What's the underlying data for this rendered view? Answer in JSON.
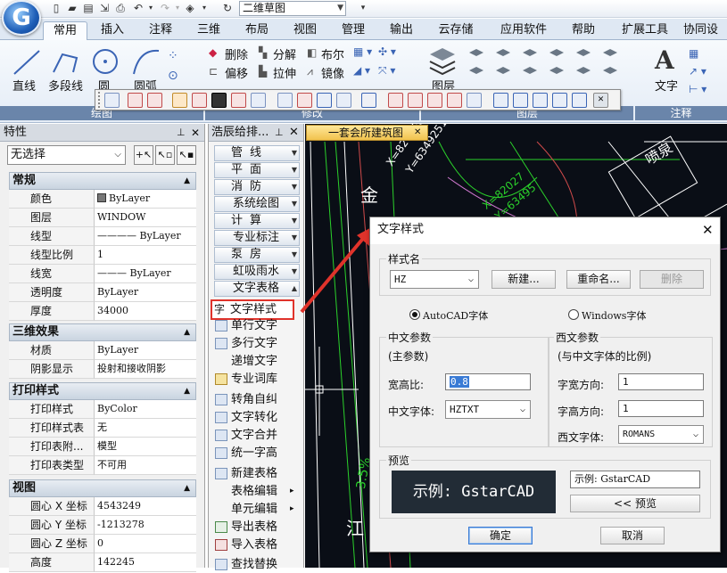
{
  "app": {
    "logo": "G",
    "view_selector": "二维草图"
  },
  "ribbon": {
    "tabs": [
      "常用",
      "插入",
      "注释",
      "三维",
      "布局",
      "视图",
      "管理",
      "输出",
      "云存储",
      "应用软件",
      "帮助",
      "扩展工具",
      "协同设"
    ],
    "active_tab": "常用",
    "draw_tools": [
      "直线",
      "多段线",
      "圆",
      "圆弧"
    ],
    "modify_tools": [
      "删除",
      "分解",
      "布尔",
      "偏移",
      "拉伸",
      "镜像"
    ],
    "big_tools": [
      "图层",
      "文字"
    ],
    "group_labels": [
      "绘图",
      "修改",
      "图层",
      "注释"
    ]
  },
  "properties": {
    "title": "特性",
    "selection": "无选择",
    "sections": [
      {
        "name": "常规",
        "rows": [
          [
            "颜色",
            "ByLayer"
          ],
          [
            "图层",
            "WINDOW"
          ],
          [
            "线型",
            "———— ByLayer"
          ],
          [
            "线型比例",
            "1"
          ],
          [
            "线宽",
            "——— ByLayer"
          ],
          [
            "透明度",
            "ByLayer"
          ],
          [
            "厚度",
            "34000"
          ]
        ]
      },
      {
        "name": "三维效果",
        "rows": [
          [
            "材质",
            "ByLayer"
          ],
          [
            "阴影显示",
            "投射和接收阴影"
          ]
        ]
      },
      {
        "name": "打印样式",
        "rows": [
          [
            "打印样式",
            "ByColor"
          ],
          [
            "打印样式表",
            "无"
          ],
          [
            "打印表附...",
            "模型"
          ],
          [
            "打印表类型",
            "不可用"
          ]
        ]
      },
      {
        "name": "视图",
        "rows": [
          [
            "圆心 X 坐标",
            "4543249"
          ],
          [
            "圆心 Y 坐标",
            "-1213278"
          ],
          [
            "圆心 Z 坐标",
            "0"
          ],
          [
            "高度",
            "142245"
          ]
        ]
      }
    ]
  },
  "palette": {
    "title": "浩辰给排...",
    "categories": [
      "管线",
      "平面",
      "消防",
      "系统绘图",
      "计算",
      "专业标注",
      "泵房",
      "虹吸雨水",
      "文字表格"
    ],
    "items": [
      "文字样式",
      "单行文字",
      "多行文字",
      "递增文字",
      "专业词库",
      "转角自纠",
      "文字转化",
      "文字合并",
      "统一字高",
      "新建表格",
      "表格编辑",
      "单元编辑",
      "导出表格",
      "导入表格",
      "查找替换"
    ]
  },
  "drawing": {
    "tab": "一套会所建筑图",
    "labels": [
      "金",
      "江",
      "喷泉",
      "X=8202583",
      "Y=6349251",
      "X=82027",
      "Y=63495",
      "3.5%"
    ]
  },
  "dialog": {
    "title": "文字样式",
    "style_name_label": "样式名",
    "style_name": "HZ",
    "btn_new": "新建...",
    "btn_rename": "重命名...",
    "btn_delete": "删除",
    "radio_autocad": "AutoCAD字体",
    "radio_windows": "Windows字体",
    "cn_params_title": "中文参数",
    "cn_params_sub": "(主参数)",
    "ratio_label": "宽高比:",
    "ratio_value": "0.8",
    "cn_font_label": "中文字体:",
    "cn_font_value": "HZTXT",
    "west_title": "西文参数",
    "west_sub": "(与中文字体的比例)",
    "char_width_label": "字宽方向:",
    "char_width_value": "1",
    "char_height_label": "字高方向:",
    "char_height_value": "1",
    "west_font_label": "西文字体:",
    "west_font_value": "ROMANS",
    "preview_title": "预览",
    "preview_text": "示例: GstarCAD",
    "sample_input": "示例: GstarCAD",
    "preview_btn": "<< 预览",
    "ok": "确定",
    "cancel": "取消",
    "close": "✕"
  }
}
